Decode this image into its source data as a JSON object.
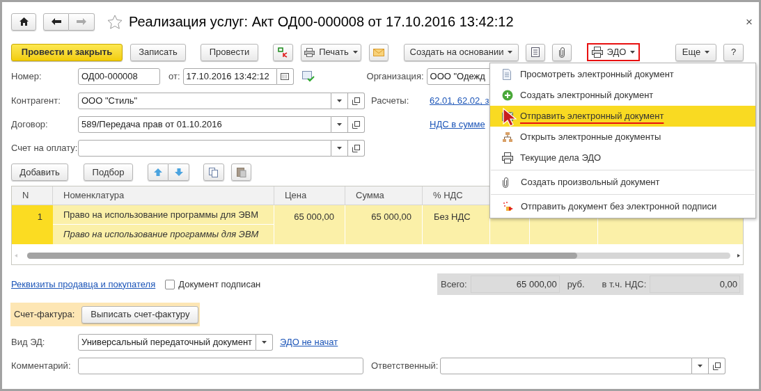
{
  "window": {
    "title": "Реализация услуг: Акт ОД00-000008 от 17.10.2016 13:42:12",
    "close": "×"
  },
  "toolbar": {
    "post_and_close": "Провести и закрыть",
    "write": "Записать",
    "post": "Провести",
    "print": "Печать",
    "create_based_on": "Создать на основании",
    "edo": {
      "label": "ЭДО",
      "highlighted": true
    },
    "more": "Еще",
    "help": "?"
  },
  "header": {
    "number": {
      "label": "Номер:",
      "value": "ОД00-000008"
    },
    "date": {
      "label": "от:",
      "value": "17.10.2016 13:42:12"
    },
    "organization": {
      "label": "Организация:",
      "value": "ООО \"Одежд"
    },
    "counterparty": {
      "label": "Контрагент:",
      "value": "ООО \"Стиль\""
    },
    "settlements": {
      "label": "Расчеты:",
      "link": "62.01, 62.02, з"
    },
    "contract": {
      "label": "Договор:",
      "value": "589/Передача прав от 01.10.2016"
    },
    "vat_link": "НДС в сумме",
    "invoice_for_payment": {
      "label": "Счет на оплату:"
    }
  },
  "table_toolbar": {
    "add": "Добавить",
    "pick": "Подбор"
  },
  "table": {
    "columns": [
      "N",
      "Номенклатура",
      "Цена",
      "Сумма",
      "% НДС"
    ],
    "rows": [
      {
        "n": "1",
        "item": "Право на использование программы для ЭВМ",
        "content": "Право на использование программы для ЭВМ",
        "price": "65 000,00",
        "sum": "65 000,00",
        "vat": "Без НДС",
        "selected": true
      }
    ]
  },
  "below_table": {
    "requisites_link": "Реквизиты продавца и покупателя",
    "signed": {
      "label": "Документ подписан",
      "checked": false
    }
  },
  "totals": {
    "total_label": "Всего:",
    "total": "65 000,00",
    "currency": "руб.",
    "vat_label": "в т.ч. НДС:",
    "vat": "0,00"
  },
  "invoice": {
    "label": "Счет-фактура:",
    "button": "Выписать счет-фактуру"
  },
  "ed_type": {
    "label": "Вид ЭД:",
    "value": "Универсальный передаточный документ",
    "status_link": "ЭДО не начат"
  },
  "comment": {
    "label": "Комментарий:"
  },
  "responsible": {
    "label": "Ответственный:"
  },
  "edo_menu": {
    "groups": [
      [
        {
          "label": "Просмотреть электронный документ",
          "selected": false
        },
        {
          "label": "Создать электронный документ",
          "selected": false
        },
        {
          "label": "Отправить электронный документ",
          "selected": true
        },
        {
          "label": "Открыть электронные документы",
          "selected": false
        },
        {
          "label": "Текущие дела ЭДО",
          "selected": false
        }
      ],
      [
        {
          "label": "Создать произвольный документ",
          "selected": false
        }
      ],
      [
        {
          "label": "Отправить документ без электронной подписи",
          "selected": false
        }
      ]
    ]
  }
}
